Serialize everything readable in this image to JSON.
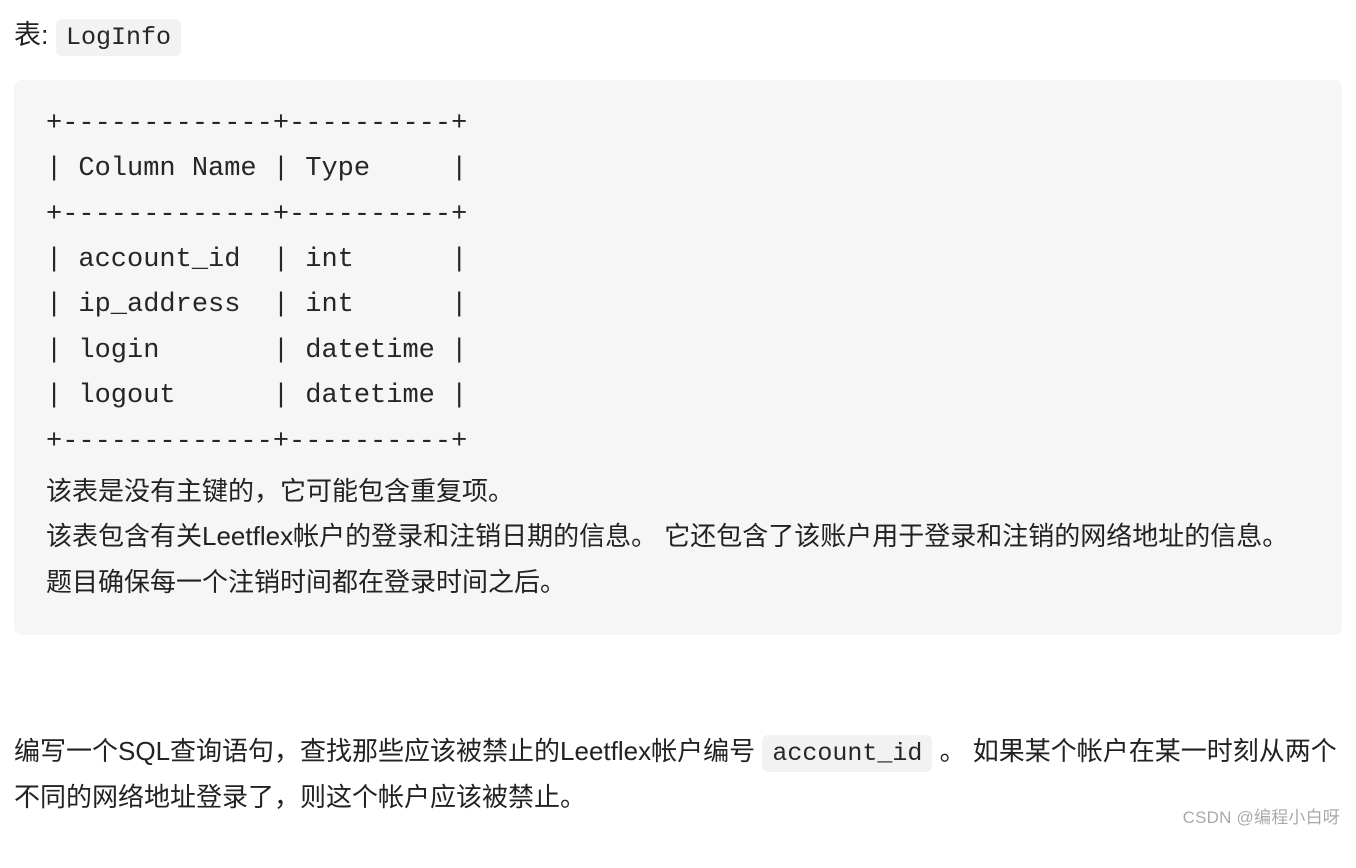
{
  "title": {
    "prefix": "表: ",
    "table_name": "LogInfo"
  },
  "schema_ascii": "+-------------+----------+\n| Column Name | Type     |\n+-------------+----------+\n| account_id  | int      |\n| ip_address  | int      |\n| login       | datetime |\n| logout      | datetime |\n+-------------+----------+",
  "schema_desc": {
    "line1": "该表是没有主键的，它可能包含重复项。",
    "line2": "该表包含有关Leetflex帐户的登录和注销日期的信息。 它还包含了该账户用于登录和注销的网络地址的信息。",
    "line3": "题目确保每一个注销时间都在登录时间之后。"
  },
  "question": {
    "part1": "编写一个SQL查询语句，查找那些应该被禁止的Leetflex帐户编号 ",
    "code": "account_id",
    "part2": " 。 如果某个帐户在某一时刻从两个不同的网络地址登录了，则这个帐户应该被禁止。"
  },
  "watermark": "CSDN @编程小白呀",
  "chart_data": {
    "type": "table",
    "title": "LogInfo schema",
    "categories": [
      "Column Name",
      "Type"
    ],
    "series": [
      {
        "name": "account_id",
        "values": [
          "int"
        ]
      },
      {
        "name": "ip_address",
        "values": [
          "int"
        ]
      },
      {
        "name": "login",
        "values": [
          "datetime"
        ]
      },
      {
        "name": "logout",
        "values": [
          "datetime"
        ]
      }
    ]
  }
}
